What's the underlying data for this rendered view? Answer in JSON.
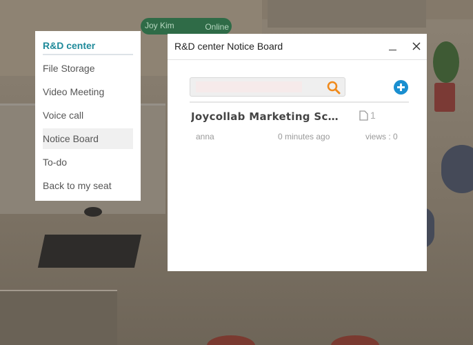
{
  "user_badge": {
    "name": "Joy Kim",
    "status": "Online",
    "color": "#2f6b47"
  },
  "side_menu": {
    "title": "R&D center",
    "accent": "#1f8a9a",
    "items": [
      {
        "label": "File Storage"
      },
      {
        "label": "Video Meeting"
      },
      {
        "label": "Voice call"
      },
      {
        "label": "Notice Board",
        "active": true
      },
      {
        "label": "To-do"
      },
      {
        "label": "Back to my seat"
      }
    ]
  },
  "dialog": {
    "title": "R&D center Notice Board",
    "minimize_icon": "minimize-icon",
    "close_icon": "close-icon",
    "search": {
      "value": "",
      "placeholder": "",
      "icon": "search-icon",
      "icon_color": "#f08a1c"
    },
    "add_icon": "plus-circle-icon",
    "add_color": "#1a8fd0",
    "posts": [
      {
        "title": "Joycollab Marketing Schedule",
        "attachment_count": "1",
        "author": "anna",
        "time": "0 minutes ago",
        "views": "views : 0"
      }
    ]
  }
}
